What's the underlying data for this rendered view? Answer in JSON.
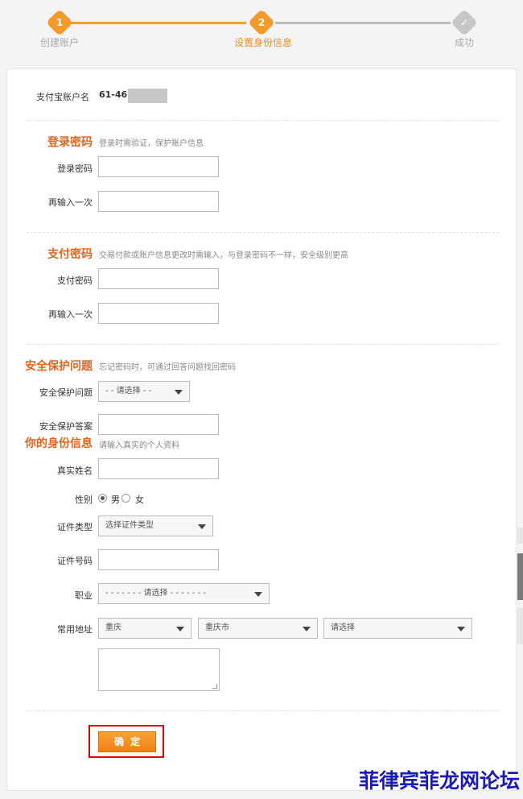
{
  "steps": [
    {
      "num": "1",
      "label": "创建账户"
    },
    {
      "num": "2",
      "label": "设置身份信息"
    },
    {
      "num": "",
      "label": "成功"
    }
  ],
  "account": {
    "label": "支付宝账户名",
    "value": "61-467"
  },
  "login_pw": {
    "title": "登录密码",
    "hint": "登录时需验证，保护账户信息",
    "field1_label": "登录密码",
    "field2_label": "再输入一次"
  },
  "pay_pw": {
    "title": "支付密码",
    "hint": "交易付款或账户信息更改时需输入，与登录密码不一样，安全级别更高",
    "field1_label": "支付密码",
    "field2_label": "再输入一次"
  },
  "security": {
    "title": "安全保护问题",
    "hint": "忘记密码时，可通过回答问题找回密码",
    "question_label": "安全保护问题",
    "question_value": "- - 请选择 - -",
    "answer_label": "安全保护答案"
  },
  "identity": {
    "title": "你的身份信息",
    "hint": "请输入真实的个人资料",
    "name_label": "真实姓名",
    "gender_label": "性别",
    "gender_male": "男",
    "gender_female": "女",
    "id_type_label": "证件类型",
    "id_type_value": "选择证件类型",
    "id_number_label": "证件号码",
    "job_label": "职业",
    "job_value": "- - - - - - - 请选择 - - - - - - -",
    "address_label": "常用地址",
    "address_province": "重庆",
    "address_city": "重庆市",
    "address_district": "请选择"
  },
  "confirm_label": "确定",
  "watermark": "菲律宾菲龙网论坛",
  "colors": {
    "accent": "#f08c1e",
    "title_orange": "#e0661e",
    "highlight_red": "#e10000",
    "watermark_blue": "#1a1ab8"
  }
}
